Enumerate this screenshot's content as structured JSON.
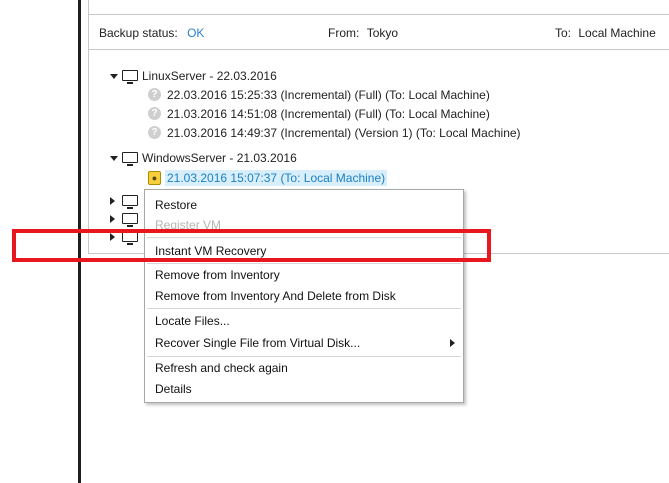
{
  "status_bar": {
    "backup_label": "Backup status:",
    "backup_value": "OK",
    "from_label": "From:",
    "from_value": "Tokyo",
    "to_label": "To:",
    "to_value": "Local Machine"
  },
  "tree": {
    "linux_server": {
      "label": "LinuxServer - 22.03.2016",
      "children": [
        "22.03.2016 15:25:33 (Incremental) (Full) (To: Local Machine)",
        "21.03.2016 14:51:08 (Incremental) (Full) (To: Local Machine)",
        "21.03.2016 14:49:37 (Incremental) (Version 1) (To: Local Machine)"
      ]
    },
    "windows_server": {
      "label": "WindowsServer - 21.03.2016",
      "selected_child": "21.03.2016 15:07:37 (To: Local Machine)"
    }
  },
  "context_menu": {
    "items": [
      {
        "label": "Restore",
        "enabled": true
      },
      {
        "label": "Register VM",
        "enabled": false
      },
      {
        "label": "Instant VM Recovery",
        "enabled": true
      },
      {
        "label": "Remove from Inventory",
        "enabled": true
      },
      {
        "label": "Remove from Inventory And Delete from Disk",
        "enabled": true
      },
      {
        "label": "Locate Files...",
        "enabled": true
      },
      {
        "label": "Recover Single File from Virtual Disk...",
        "enabled": true,
        "submenu": true
      },
      {
        "label": "Refresh and check again",
        "enabled": true
      },
      {
        "label": "Details",
        "enabled": true
      }
    ]
  },
  "colors": {
    "highlight_box": "#e8171d",
    "status_ok": "#2a7fd4",
    "selection_bg": "#d9eefb",
    "selection_text": "#1a80c4"
  },
  "icons": {
    "server": "monitor-icon",
    "unknown_state": "question-icon",
    "locked_backup": "lock-icon",
    "expand": "caret-icon"
  }
}
